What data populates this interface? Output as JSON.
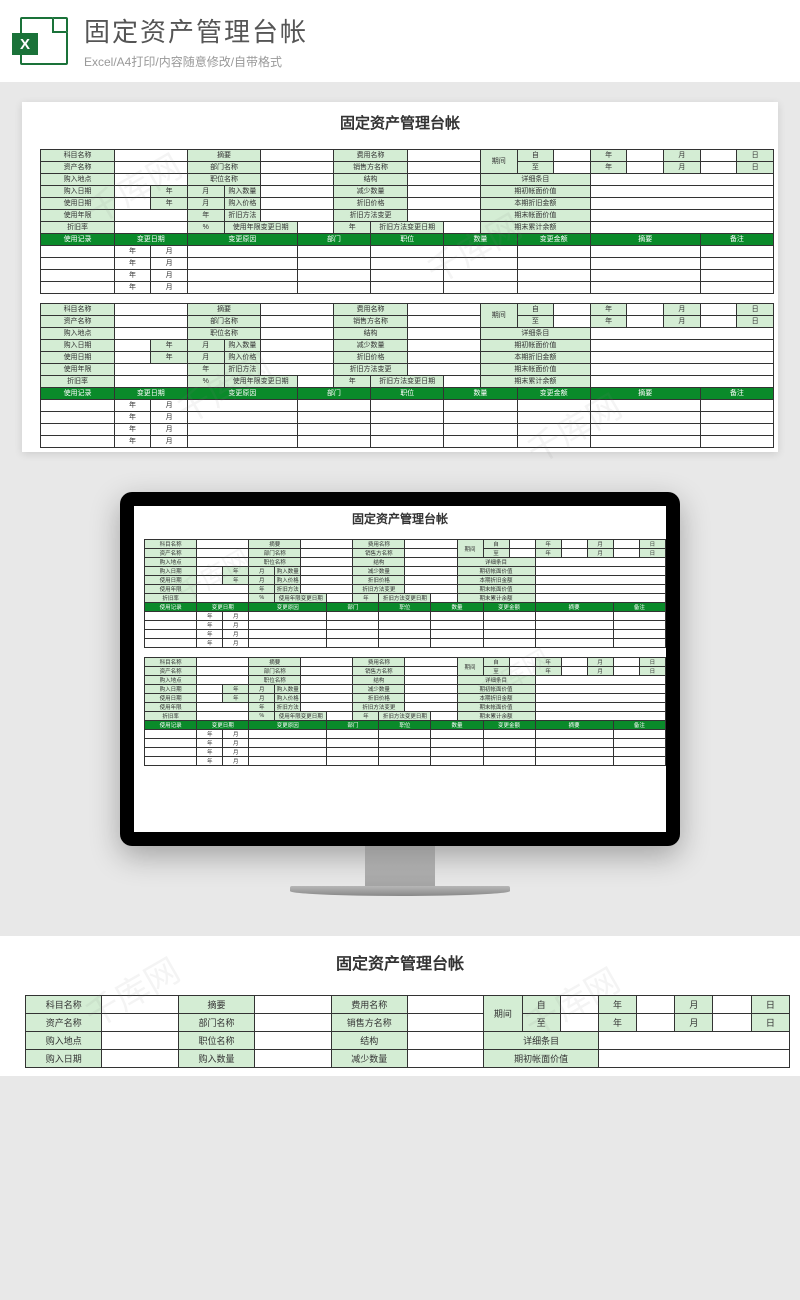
{
  "header": {
    "title": "固定资产管理台帐",
    "subtitle": "Excel/A4打印/内容随意修改/自带格式"
  },
  "sheet": {
    "title": "固定资产管理台帐",
    "labels": {
      "subject": "科目名称",
      "summary": "摘要",
      "expense": "费用名称",
      "period": "期间",
      "from": "自",
      "to": "至",
      "year": "年",
      "month": "月",
      "day": "日",
      "assetName": "资产名称",
      "department": "部门名称",
      "seller": "销售方名称",
      "buyPlace": "购入地点",
      "position": "职位名称",
      "structure": "结构",
      "detail": "详细条目",
      "buyDate": "购入日期",
      "buyQty": "购入数量",
      "reduceQty": "减少数量",
      "openRemain": "期初帐面价值",
      "useDate": "使用日期",
      "buyPrice": "购入价格",
      "depPrice": "折旧价格",
      "curDep": "本期折旧金额",
      "useYears": "使用年限",
      "depMethod": "折旧方法",
      "depMethodChange": "折旧方法变更",
      "closeRemain": "期末帐面价值",
      "depRate": "折旧率",
      "pct": "%",
      "useYearChangeDate": "使用年限变更日期",
      "depMethodChangeDate": "折旧方法变更日期",
      "accumDep": "期末累计余额"
    },
    "greenHeader": [
      "使用记录",
      "变更日期",
      "变更原因",
      "部门",
      "职位",
      "数量",
      "变更金额",
      "摘要",
      "备注"
    ]
  },
  "watermark": "千库网"
}
